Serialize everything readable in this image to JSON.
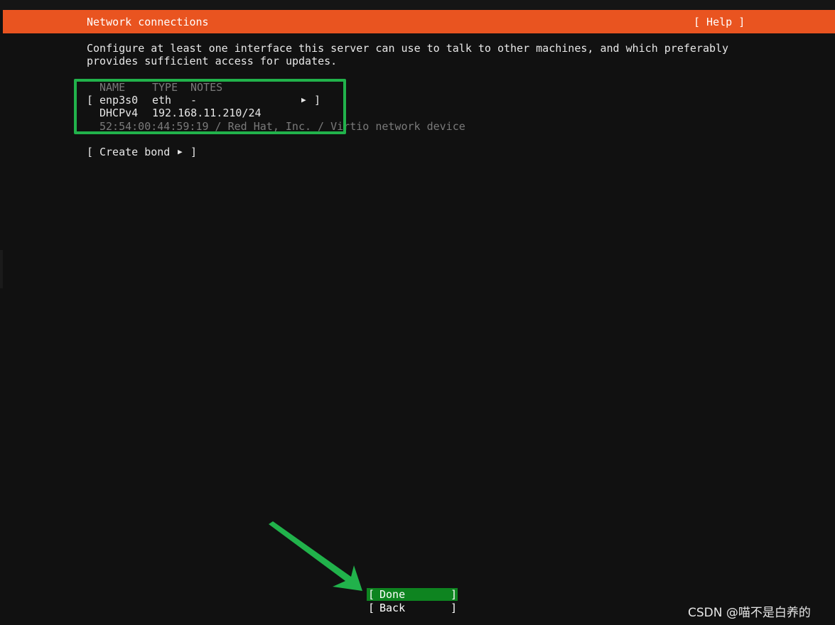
{
  "header": {
    "title": "Network connections",
    "help_label": "[ Help ]",
    "color": "#e95420"
  },
  "intro": {
    "line1": "Configure at least one interface this server can use to talk to other machines, and which preferably",
    "line2": "provides sufficient access for updates."
  },
  "table": {
    "columns": [
      "NAME",
      "TYPE",
      "NOTES"
    ],
    "interfaces": [
      {
        "bracket_open": "[",
        "name": "enp3s0",
        "type": "eth",
        "notes": "-",
        "arrow_icon": "▶",
        "bracket_close": "]",
        "address_type": "DHCPv4",
        "address": "192.168.11.210/24",
        "hw_info": "52:54:00:44:59:19 / Red Hat, Inc. / Virtio network device"
      }
    ]
  },
  "actions": {
    "create_bond": {
      "open": "[",
      "label": "Create bond",
      "arrow_icon": "▶",
      "close": "]"
    }
  },
  "buttons": {
    "done": {
      "open": "[",
      "label": "Done",
      "close": "]",
      "highlight_color": "#0e8420"
    },
    "back": {
      "open": "[",
      "label": "Back",
      "close": "]"
    }
  },
  "annotations": {
    "color": "#21b24b"
  },
  "watermark": {
    "text": "CSDN @喵不是白养的"
  }
}
